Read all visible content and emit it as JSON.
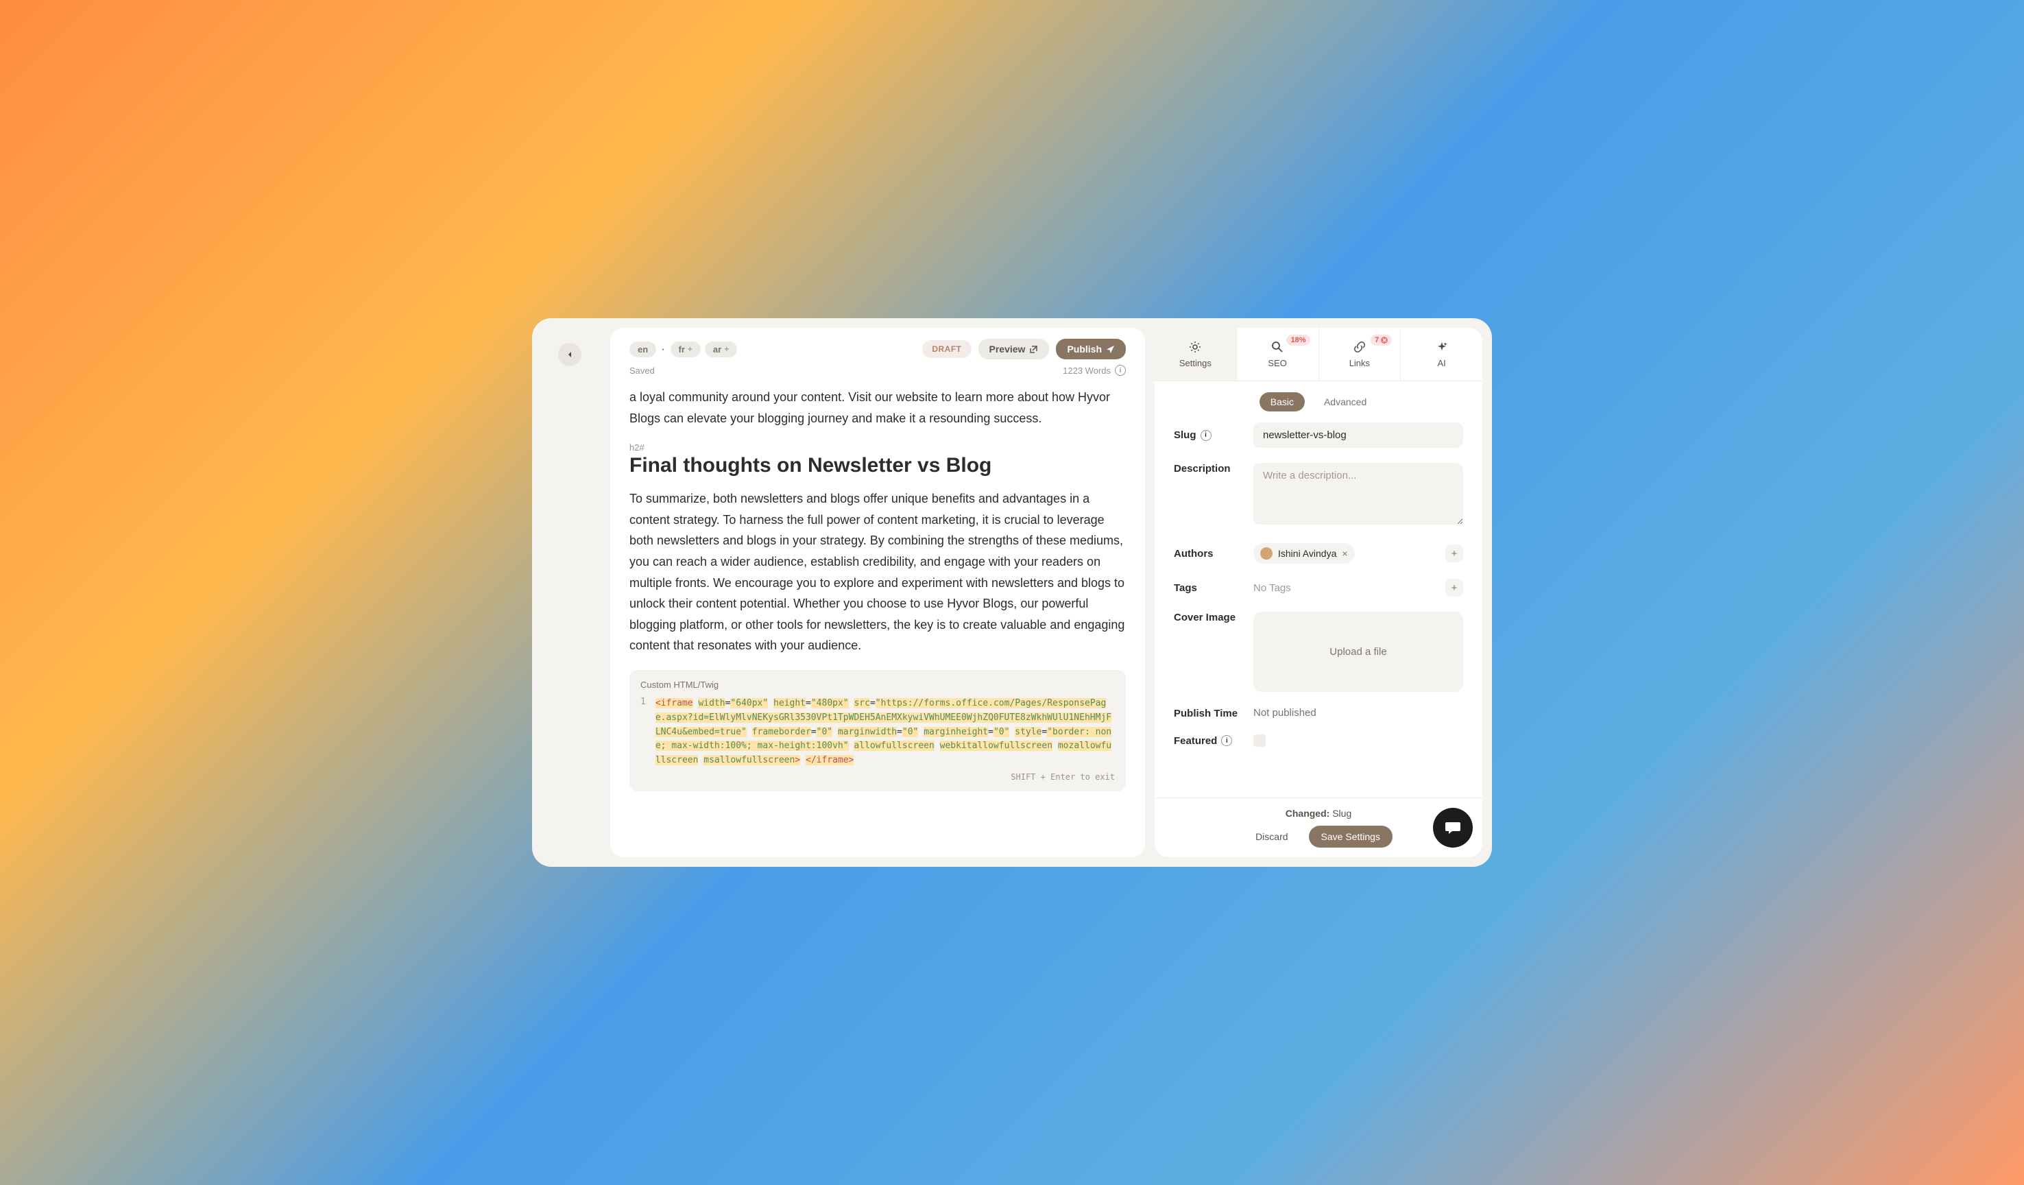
{
  "header": {
    "languages": [
      "en",
      "fr",
      "ar"
    ],
    "draft_label": "DRAFT",
    "preview_label": "Preview",
    "publish_label": "Publish",
    "saved_label": "Saved",
    "word_count": "1223 Words"
  },
  "content": {
    "intro_para": "a loyal community around your content. Visit our website to learn more about how Hyvor Blogs can elevate your blogging journey and make it a resounding success.",
    "h2_marker": "h2#",
    "heading": "Final thoughts on Newsletter vs Blog",
    "body_para": "To summarize, both newsletters and blogs offer unique benefits and advantages in a content strategy. To harness the full power of content marketing, it is crucial to leverage both newsletters and blogs in your strategy. By combining the strengths of these mediums, you can reach a wider audience, establish credibility, and engage with your readers on multiple fronts. We encourage you to explore and experiment with newsletters and blogs to unlock their content potential. Whether you choose to use Hyvor Blogs, our powerful blogging platform, or other tools for newsletters, the key is to create valuable and engaging content that resonates with your audience.",
    "code_label": "Custom HTML/Twig",
    "code_line_num": "1",
    "code_hint": "SHIFT + Enter to exit"
  },
  "sidebar": {
    "tabs": {
      "settings": "Settings",
      "seo": "SEO",
      "seo_badge": "18%",
      "links": "Links",
      "links_badge": "7",
      "ai": "AI"
    },
    "toggle": {
      "basic": "Basic",
      "advanced": "Advanced"
    },
    "form": {
      "slug_label": "Slug",
      "slug_value": "newsletter-vs-blog",
      "description_label": "Description",
      "description_placeholder": "Write a description...",
      "authors_label": "Authors",
      "author_name": "Ishini Avindya",
      "tags_label": "Tags",
      "no_tags": "No Tags",
      "cover_label": "Cover Image",
      "upload_text": "Upload a file",
      "publish_time_label": "Publish Time",
      "publish_time_value": "Not published",
      "featured_label": "Featured"
    },
    "footer": {
      "changed_prefix": "Changed: ",
      "changed_field": "Slug",
      "discard": "Discard",
      "save": "Save Settings"
    }
  }
}
